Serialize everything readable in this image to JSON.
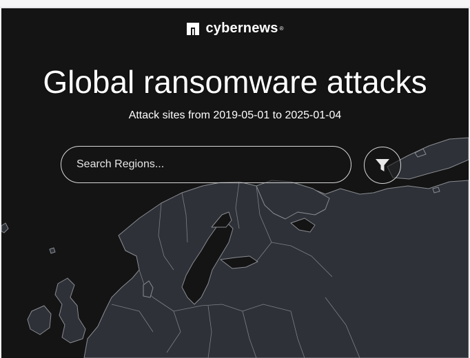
{
  "brand": {
    "name": "cybernews",
    "reg_mark": "®"
  },
  "title": "Global ransomware attacks",
  "subtitle": "Attack sites from 2019-05-01 to 2025-01-04",
  "search": {
    "placeholder": "Search Regions...",
    "value": ""
  },
  "filter": {
    "icon": "filter-icon"
  },
  "map": {
    "region": "Europe",
    "land_color": "#2e3137",
    "border_color": "#8a8d93",
    "sea_color": "#141414"
  }
}
